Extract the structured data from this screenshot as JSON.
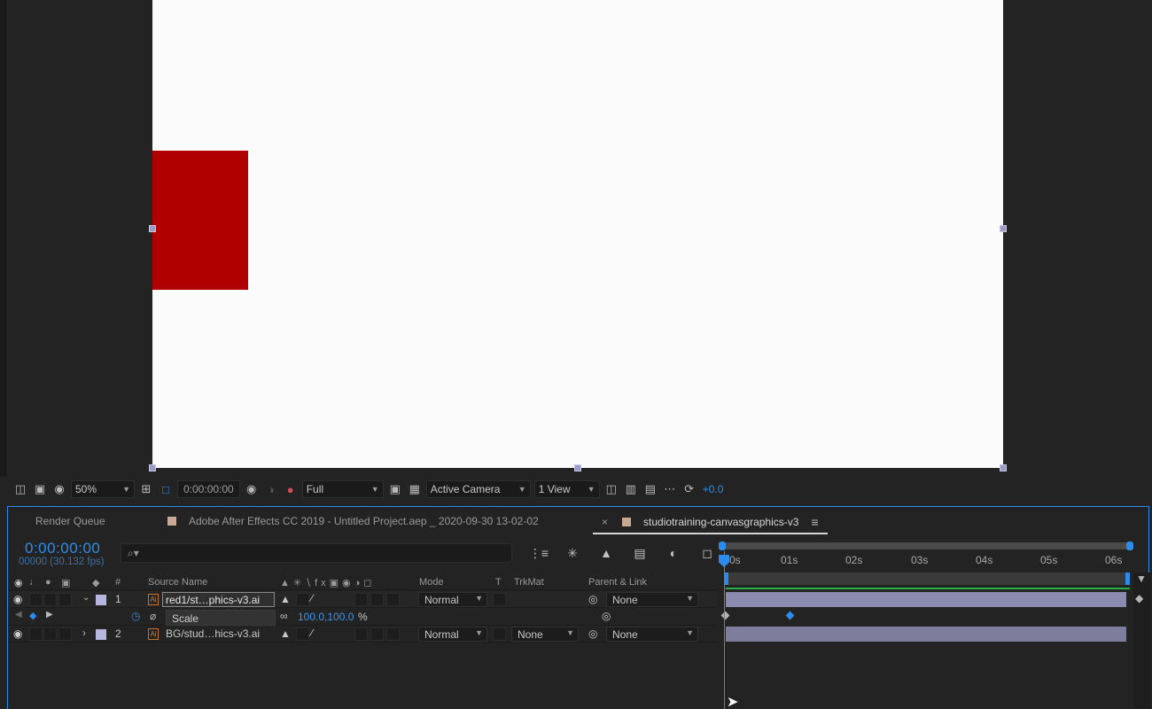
{
  "viewer_toolbar": {
    "zoom": "50%",
    "timecode": "0:00:00:00",
    "resolution": "Full",
    "camera": "Active Camera",
    "views": "1 View",
    "exposure": "+0.0"
  },
  "tabs": {
    "render_queue": "Render Queue",
    "project": "Adobe After Effects CC 2019 - Untitled Project.aep _ 2020-09-30 13-02-02",
    "comp": "studiotraining-canvasgraphics-v3",
    "close": "×",
    "menu": "≡"
  },
  "timeline": {
    "timecode": "0:00:00:00",
    "fps": "00000 (30.132 fps)",
    "search_placeholder": "⌕▾",
    "columns": {
      "num": "#",
      "source_name": "Source Name",
      "mode": "Mode",
      "t": "T",
      "trkmat": "TrkMat",
      "parent": "Parent & Link"
    },
    "layers": [
      {
        "num": "1",
        "name": "red1/st…phics-v3.ai",
        "mode": "Normal",
        "parent": "None"
      },
      {
        "num": "2",
        "name": "BG/stud…hics-v3.ai",
        "mode": "Normal",
        "trkmat": "None",
        "parent": "None"
      }
    ],
    "property": {
      "name": "Scale",
      "value": "100.0,100.0",
      "unit": "%"
    },
    "ruler": [
      "0s",
      "01s",
      "02s",
      "03s",
      "04s",
      "05s",
      "06s"
    ]
  },
  "colors": {
    "accent": "#2d8ceb",
    "layer_red": "#b00000",
    "layer_label": "#b6b6e0"
  }
}
